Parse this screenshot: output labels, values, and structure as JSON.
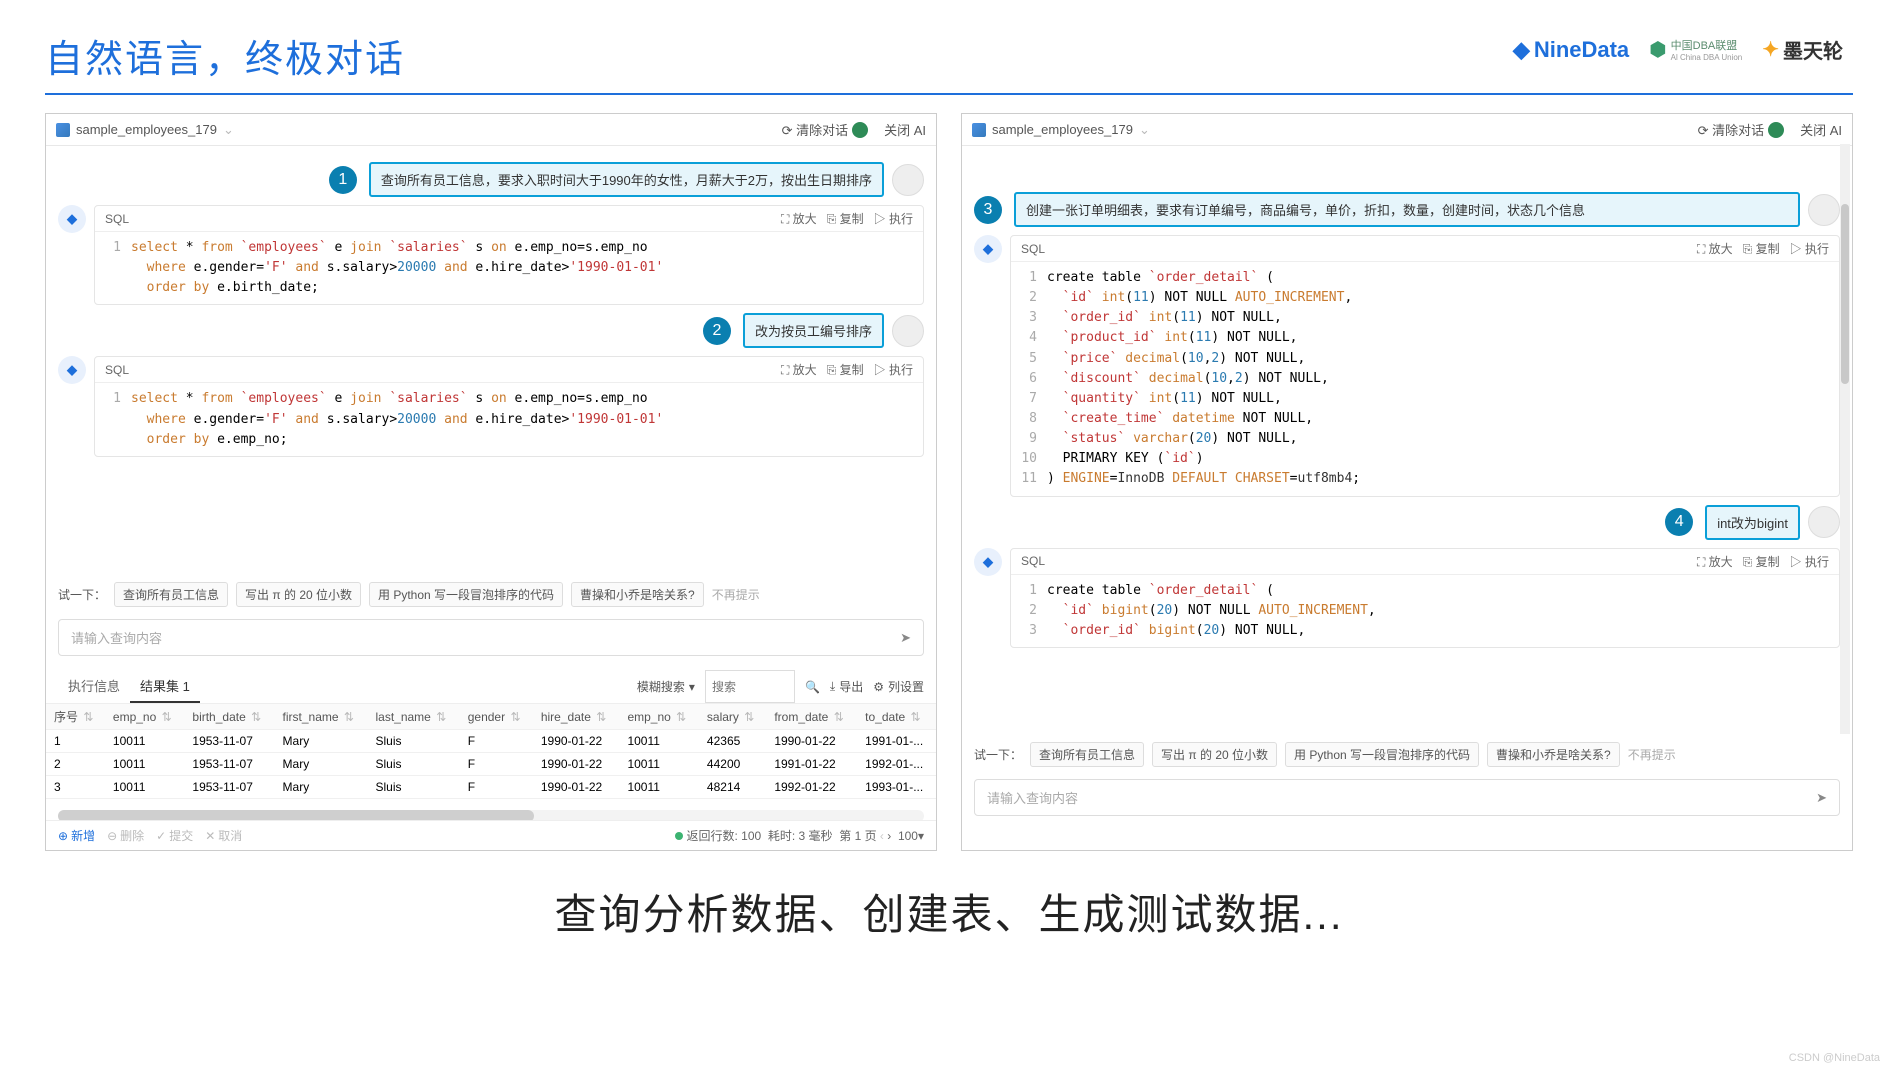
{
  "slide": {
    "title": "自然语言，终极对话",
    "caption": "查询分析数据、创建表、生成测试数据...",
    "watermark": "CSDN @NineData"
  },
  "logos": {
    "ninedata": "NineData",
    "dba": "中国DBA联盟",
    "dba_sub": "Al China DBA Union",
    "motian": "墨天轮"
  },
  "header": {
    "db_name": "sample_employees_179",
    "clear": "清除对话",
    "close": "关闭 AI"
  },
  "left": {
    "msg1": "查询所有员工信息，要求入职时间大于1990年的女性，月薪大于2万，按出生日期排序",
    "msg2": "改为按员工编号排序",
    "sql_label": "SQL",
    "expand": "放大",
    "copy": "复制",
    "run": "执行",
    "code1": [
      {
        "n": "1",
        "t": "select * from `employees` e join `salaries` s on e.emp_no=s.emp_no"
      },
      {
        "n": " ",
        "t": "  where e.gender='F' and s.salary>20000 and e.hire_date>'1990-01-01'"
      },
      {
        "n": " ",
        "t": "  order by e.birth_date;"
      }
    ],
    "code2": [
      {
        "n": "1",
        "t": "select * from `employees` e join `salaries` s on e.emp_no=s.emp_no"
      },
      {
        "n": " ",
        "t": "  where e.gender='F' and s.salary>20000 and e.hire_date>'1990-01-01'"
      },
      {
        "n": " ",
        "t": "  order by e.emp_no;"
      }
    ],
    "suggest_label": "试一下：",
    "chips": [
      "查询所有员工信息",
      "写出 π 的 20 位小数",
      "用 Python 写一段冒泡排序的代码",
      "曹操和小乔是啥关系?"
    ],
    "no_hint": "不再提示",
    "input_ph": "请输入查询内容",
    "tabs": {
      "exec": "执行信息",
      "result": "结果集 1",
      "fuzzy": "模糊搜索",
      "search_ph": "搜索",
      "export": "导出",
      "cols": "列设置"
    },
    "table": {
      "headers": [
        "序号",
        "emp_no",
        "birth_date",
        "first_name",
        "last_name",
        "gender",
        "hire_date",
        "emp_no",
        "salary",
        "from_date",
        "to_date"
      ],
      "rows": [
        [
          "1",
          "10011",
          "1953-11-07",
          "Mary",
          "Sluis",
          "F",
          "1990-01-22",
          "10011",
          "42365",
          "1990-01-22",
          "1991-01-..."
        ],
        [
          "2",
          "10011",
          "1953-11-07",
          "Mary",
          "Sluis",
          "F",
          "1990-01-22",
          "10011",
          "44200",
          "1991-01-22",
          "1992-01-..."
        ],
        [
          "3",
          "10011",
          "1953-11-07",
          "Mary",
          "Sluis",
          "F",
          "1990-01-22",
          "10011",
          "48214",
          "1992-01-22",
          "1993-01-..."
        ]
      ]
    },
    "footer": {
      "add": "新增",
      "del": "删除",
      "commit": "提交",
      "cancel": "取消",
      "rows": "返回行数: 100",
      "time": "耗时: 3 毫秒",
      "page": "第 1 页",
      "pagesize": "100"
    }
  },
  "right": {
    "msg3": "创建一张订单明细表，要求有订单编号，商品编号，单价，折扣，数量，创建时间，状态几个信息",
    "msg4": "int改为bigint",
    "code3": [
      {
        "n": "1",
        "t": "create table `order_detail` ("
      },
      {
        "n": "2",
        "t": "  `id` int(11) NOT NULL AUTO_INCREMENT,"
      },
      {
        "n": "3",
        "t": "  `order_id` int(11) NOT NULL,"
      },
      {
        "n": "4",
        "t": "  `product_id` int(11) NOT NULL,"
      },
      {
        "n": "5",
        "t": "  `price` decimal(10,2) NOT NULL,"
      },
      {
        "n": "6",
        "t": "  `discount` decimal(10,2) NOT NULL,"
      },
      {
        "n": "7",
        "t": "  `quantity` int(11) NOT NULL,"
      },
      {
        "n": "8",
        "t": "  `create_time` datetime NOT NULL,"
      },
      {
        "n": "9",
        "t": "  `status` varchar(20) NOT NULL,"
      },
      {
        "n": "10",
        "t": "  PRIMARY KEY (`id`)"
      },
      {
        "n": "11",
        "t": ") ENGINE=InnoDB DEFAULT CHARSET=utf8mb4;"
      }
    ],
    "code4": [
      {
        "n": "1",
        "t": "create table `order_detail` ("
      },
      {
        "n": "2",
        "t": "  `id` bigint(20) NOT NULL AUTO_INCREMENT,"
      },
      {
        "n": "3",
        "t": "  `order_id` bigint(20) NOT NULL,"
      }
    ]
  }
}
